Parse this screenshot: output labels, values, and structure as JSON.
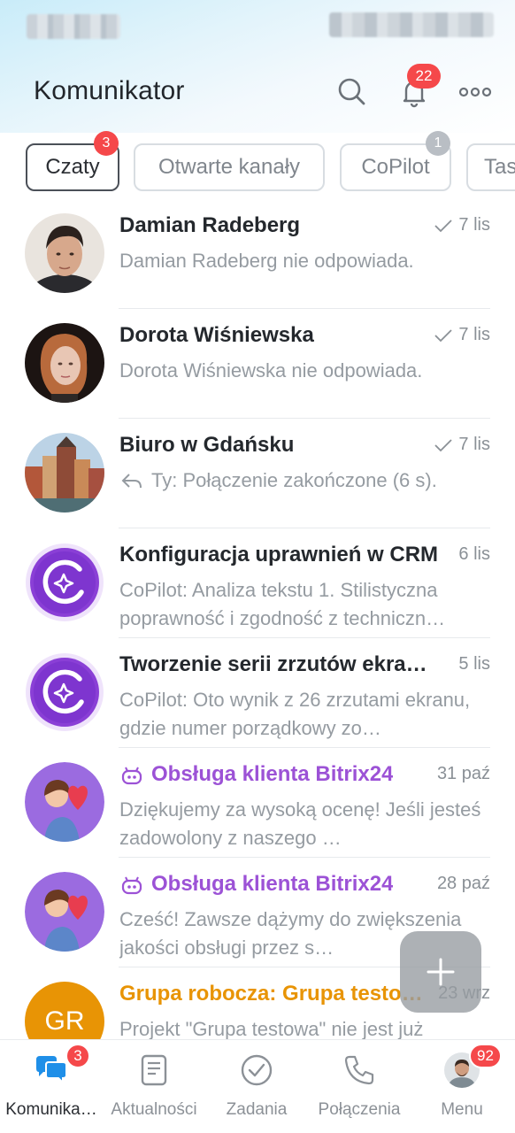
{
  "header": {
    "title": "Komunikator",
    "notifications_count": "22"
  },
  "tabs": [
    {
      "label": "Czaty",
      "badge": "3",
      "active": true
    },
    {
      "label": "Otwarte kanały",
      "badge": "",
      "active": false
    },
    {
      "label": "CoPilot",
      "badge": "1",
      "active": false
    },
    {
      "label": "Tas",
      "badge": "",
      "active": false
    }
  ],
  "chats": [
    {
      "title": "Damian Radeberg",
      "date": "7 lis",
      "read": true,
      "preview": "Damian Radeberg nie odpowiada.",
      "type": "user"
    },
    {
      "title": "Dorota Wiśniewska",
      "date": "7 lis",
      "read": true,
      "preview": "Dorota Wiśniewska nie odpowiada.",
      "type": "user"
    },
    {
      "title": "Biuro w Gdańsku",
      "date": "7 lis",
      "read": true,
      "preview": "Ty: Połączenie zakończone (6 s).",
      "type": "user"
    },
    {
      "title": "Konfiguracja uprawnień w CRM",
      "date": "6 lis",
      "read": false,
      "preview": "CoPilot: Analiza tekstu  1. Stilistyczna poprawność i zgodność z techniczn…",
      "type": "copilot"
    },
    {
      "title": "Tworzenie serii zrzutów ekra…",
      "date": "5 lis",
      "read": false,
      "preview": "CoPilot: Oto wynik z 26 zrzutami ekranu, gdzie numer porządkowy zo…",
      "type": "copilot"
    },
    {
      "title": "Obsługa klienta Bitrix24",
      "date": "31 paź",
      "read": false,
      "preview": "Dziękujemy za wysoką ocenę! Jeśli jesteś zadowolony z naszego …",
      "type": "bot"
    },
    {
      "title": "Obsługa klienta Bitrix24",
      "date": "28 paź",
      "read": false,
      "preview": "Cześć!  Zawsze dążymy do zwiększenia jakości obsługi przez s…",
      "type": "bot"
    },
    {
      "title": "Grupa robocza: Grupa testo…",
      "date": "23 wrz",
      "read": false,
      "preview": "Projekt \"Grupa testowa\" nie jest już",
      "type": "group",
      "initials": "GR"
    }
  ],
  "bottom_nav": [
    {
      "label": "Komunika…",
      "badge": "3",
      "icon": "chat-bubbles-icon",
      "active": true
    },
    {
      "label": "Aktualności",
      "badge": "",
      "icon": "news-icon",
      "active": false
    },
    {
      "label": "Zadania",
      "badge": "",
      "icon": "check-circle-icon",
      "active": false
    },
    {
      "label": "Połączenia",
      "badge": "",
      "icon": "phone-icon",
      "active": false
    },
    {
      "label": "Menu",
      "badge": "92",
      "icon": "user-avatar-icon",
      "active": false
    }
  ],
  "colors": {
    "accent_blue": "#1f8fe8",
    "badge_red": "#f5484a",
    "bot_purple": "#9c52d6",
    "group_orange": "#e89405",
    "copilot_purple": "#8a3fd6"
  }
}
